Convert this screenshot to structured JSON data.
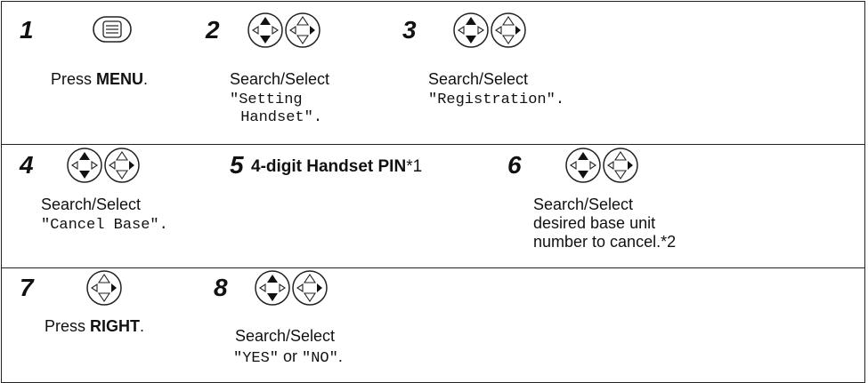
{
  "steps": {
    "s1": {
      "number": "1",
      "text_prefix": "Press ",
      "text_bold": "MENU",
      "text_suffix": ".",
      "icon": "menu-button-icon"
    },
    "s2": {
      "number": "2",
      "line1": "Search/Select",
      "mono1": "\"Setting",
      "mono2": " Handset\".",
      "icon": "navigator-up-down-icon"
    },
    "s3": {
      "number": "3",
      "line1": "Search/Select",
      "mono1": "\"Registration\".",
      "icon": "navigator-up-down-icon"
    },
    "s4": {
      "number": "4",
      "line1": "Search/Select",
      "mono1": "\"Cancel Base\".",
      "icon": "navigator-up-down-icon"
    },
    "s5": {
      "number": "5",
      "text_bold": "4-digit Handset PIN",
      "note": "*1"
    },
    "s6": {
      "number": "6",
      "line1": "Search/Select",
      "line2": "desired base unit",
      "line3": "number to cancel.*2",
      "icon": "navigator-up-down-icon"
    },
    "s7": {
      "number": "7",
      "text_prefix": "Press ",
      "text_bold": "RIGHT",
      "text_suffix": ".",
      "icon": "navigator-right-icon"
    },
    "s8": {
      "number": "8",
      "line1": "Search/Select",
      "mono_yes": "\"YES\"",
      "or_text": " or ",
      "mono_no": "\"NO\"",
      "suffix": ".",
      "icon": "navigator-up-down-icon"
    }
  }
}
